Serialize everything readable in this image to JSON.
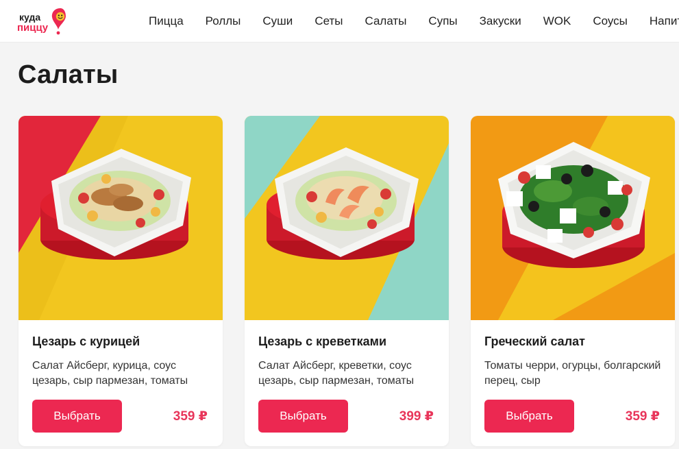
{
  "header": {
    "logo": {
      "line1": "куда",
      "line2": "пиццу"
    },
    "nav": [
      "Пицца",
      "Роллы",
      "Суши",
      "Сеты",
      "Салаты",
      "Супы",
      "Закуски",
      "WOK",
      "Соусы",
      "Напитки"
    ]
  },
  "page_title": "Салаты",
  "products": [
    {
      "name": "Цезарь с курицей",
      "description": "Салат Айсберг, курица, соус цезарь, сыр пармезан, томаты",
      "button_label": "Выбрать",
      "price": "359 ₽"
    },
    {
      "name": "Цезарь с креветками",
      "description": "Салат Айсберг, креветки, соус цезарь, сыр пармезан, томаты",
      "button_label": "Выбрать",
      "price": "399 ₽"
    },
    {
      "name": "Греческий салат",
      "description": "Томаты черри, огурцы, болгарский перец, сыр",
      "button_label": "Выбрать",
      "price": "359 ₽"
    }
  ],
  "colors": {
    "accent": "#ec2851",
    "price": "#e8355a"
  }
}
